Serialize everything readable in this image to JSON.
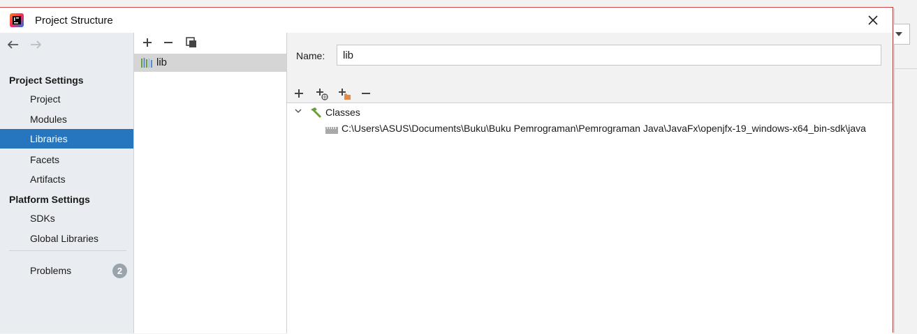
{
  "dialog": {
    "title": "Project Structure"
  },
  "nav": {
    "project_settings_header": "Project Settings",
    "project_items": [
      {
        "label": "Project"
      },
      {
        "label": "Modules"
      },
      {
        "label": "Libraries"
      },
      {
        "label": "Facets"
      },
      {
        "label": "Artifacts"
      }
    ],
    "platform_settings_header": "Platform Settings",
    "platform_items": [
      {
        "label": "SDKs"
      },
      {
        "label": "Global Libraries"
      }
    ],
    "problems_label": "Problems",
    "problems_count": "2",
    "selected": "Libraries"
  },
  "libraries": {
    "items": [
      {
        "label": "lib"
      }
    ]
  },
  "details": {
    "name_label": "Name:",
    "name_value": "lib",
    "tree": {
      "root_label": "Classes",
      "children": [
        {
          "label": "C:\\Users\\ASUS\\Documents\\Buku\\Buku Pemrograman\\Pemrograman Java\\JavaFx\\openjfx-19_windows-x64_bin-sdk\\java"
        }
      ]
    }
  },
  "colors": {
    "selection": "#2675bf",
    "nav_background": "#e9ecf0",
    "badge": "#9aa4ad"
  }
}
